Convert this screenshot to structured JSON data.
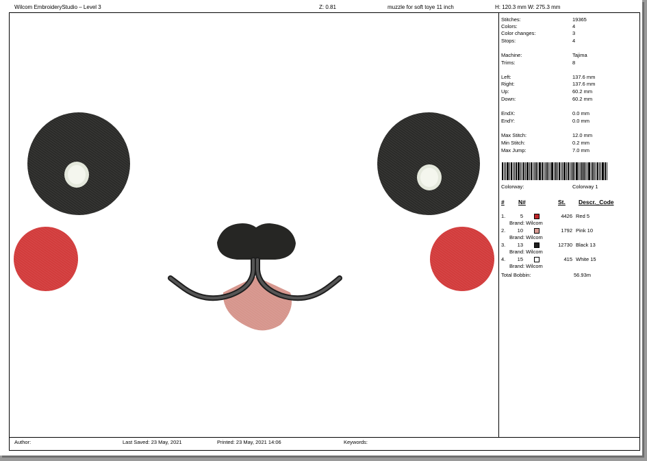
{
  "header": {
    "app_title": "Wilcom EmbroideryStudio – Level 3",
    "zoom": "Z: 0.81",
    "design_name": "muzzle for soft toye 11 inch",
    "dimensions": "H: 120.3 mm   W: 275.3 mm"
  },
  "stats": [
    {
      "label": "Stitches:",
      "value": "19365"
    },
    {
      "label": "Colors:",
      "value": "4"
    },
    {
      "label": "Color changes:",
      "value": "3"
    },
    {
      "label": "Stops:",
      "value": "4"
    },
    {
      "label": "Machine:",
      "value": "Tajima"
    },
    {
      "label": "Trims:",
      "value": "8"
    },
    {
      "label": "Left:",
      "value": "137.6 mm"
    },
    {
      "label": "Right:",
      "value": "137.6 mm"
    },
    {
      "label": "Up:",
      "value": "60.2 mm"
    },
    {
      "label": "Down:",
      "value": "60.2 mm"
    },
    {
      "label": "EndX:",
      "value": "0.0 mm"
    },
    {
      "label": "EndY:",
      "value": "0.0 mm"
    },
    {
      "label": "Max Stitch:",
      "value": "12.0 mm"
    },
    {
      "label": "Min Stitch:",
      "value": "0.2 mm"
    },
    {
      "label": "Max Jump:",
      "value": "7.0 mm"
    }
  ],
  "colorway": {
    "label": "Colorway:",
    "value": "Colorway 1"
  },
  "color_table": {
    "headers": {
      "index": "#",
      "number": "N#",
      "stitches": "St.",
      "descr": "Descr._Code"
    },
    "rows": [
      {
        "index": "1.",
        "number": "5",
        "color": "#c0262a",
        "stitches": "4426",
        "descr": "Red 5",
        "brand": "Brand: Wilcom"
      },
      {
        "index": "2.",
        "number": "10",
        "color": "#d89a92",
        "stitches": "1792",
        "descr": "Pink 10",
        "brand": "Brand: Wilcom"
      },
      {
        "index": "3.",
        "number": "13",
        "color": "#1e1e1e",
        "stitches": "12730",
        "descr": "Black 13",
        "brand": "Brand: Wilcom"
      },
      {
        "index": "4.",
        "number": "15",
        "color": "#ffffff",
        "stitches": "415",
        "descr": "White 15",
        "brand": "Brand: Wilcom"
      }
    ],
    "total_label": "Total Bobbin:",
    "total_value": "56.93m"
  },
  "footer": {
    "author": "Author:",
    "last_saved": "Last Saved: 23 May, 2021",
    "printed": "Printed: 23 May, 2021 14:06",
    "keywords": "Keywords:"
  },
  "colors": {
    "eye": "#2a2a28",
    "eye_highlight": "#eef2e8",
    "cheek": "#d23b3b",
    "nose": "#262624",
    "tongue": "#d6958c"
  }
}
